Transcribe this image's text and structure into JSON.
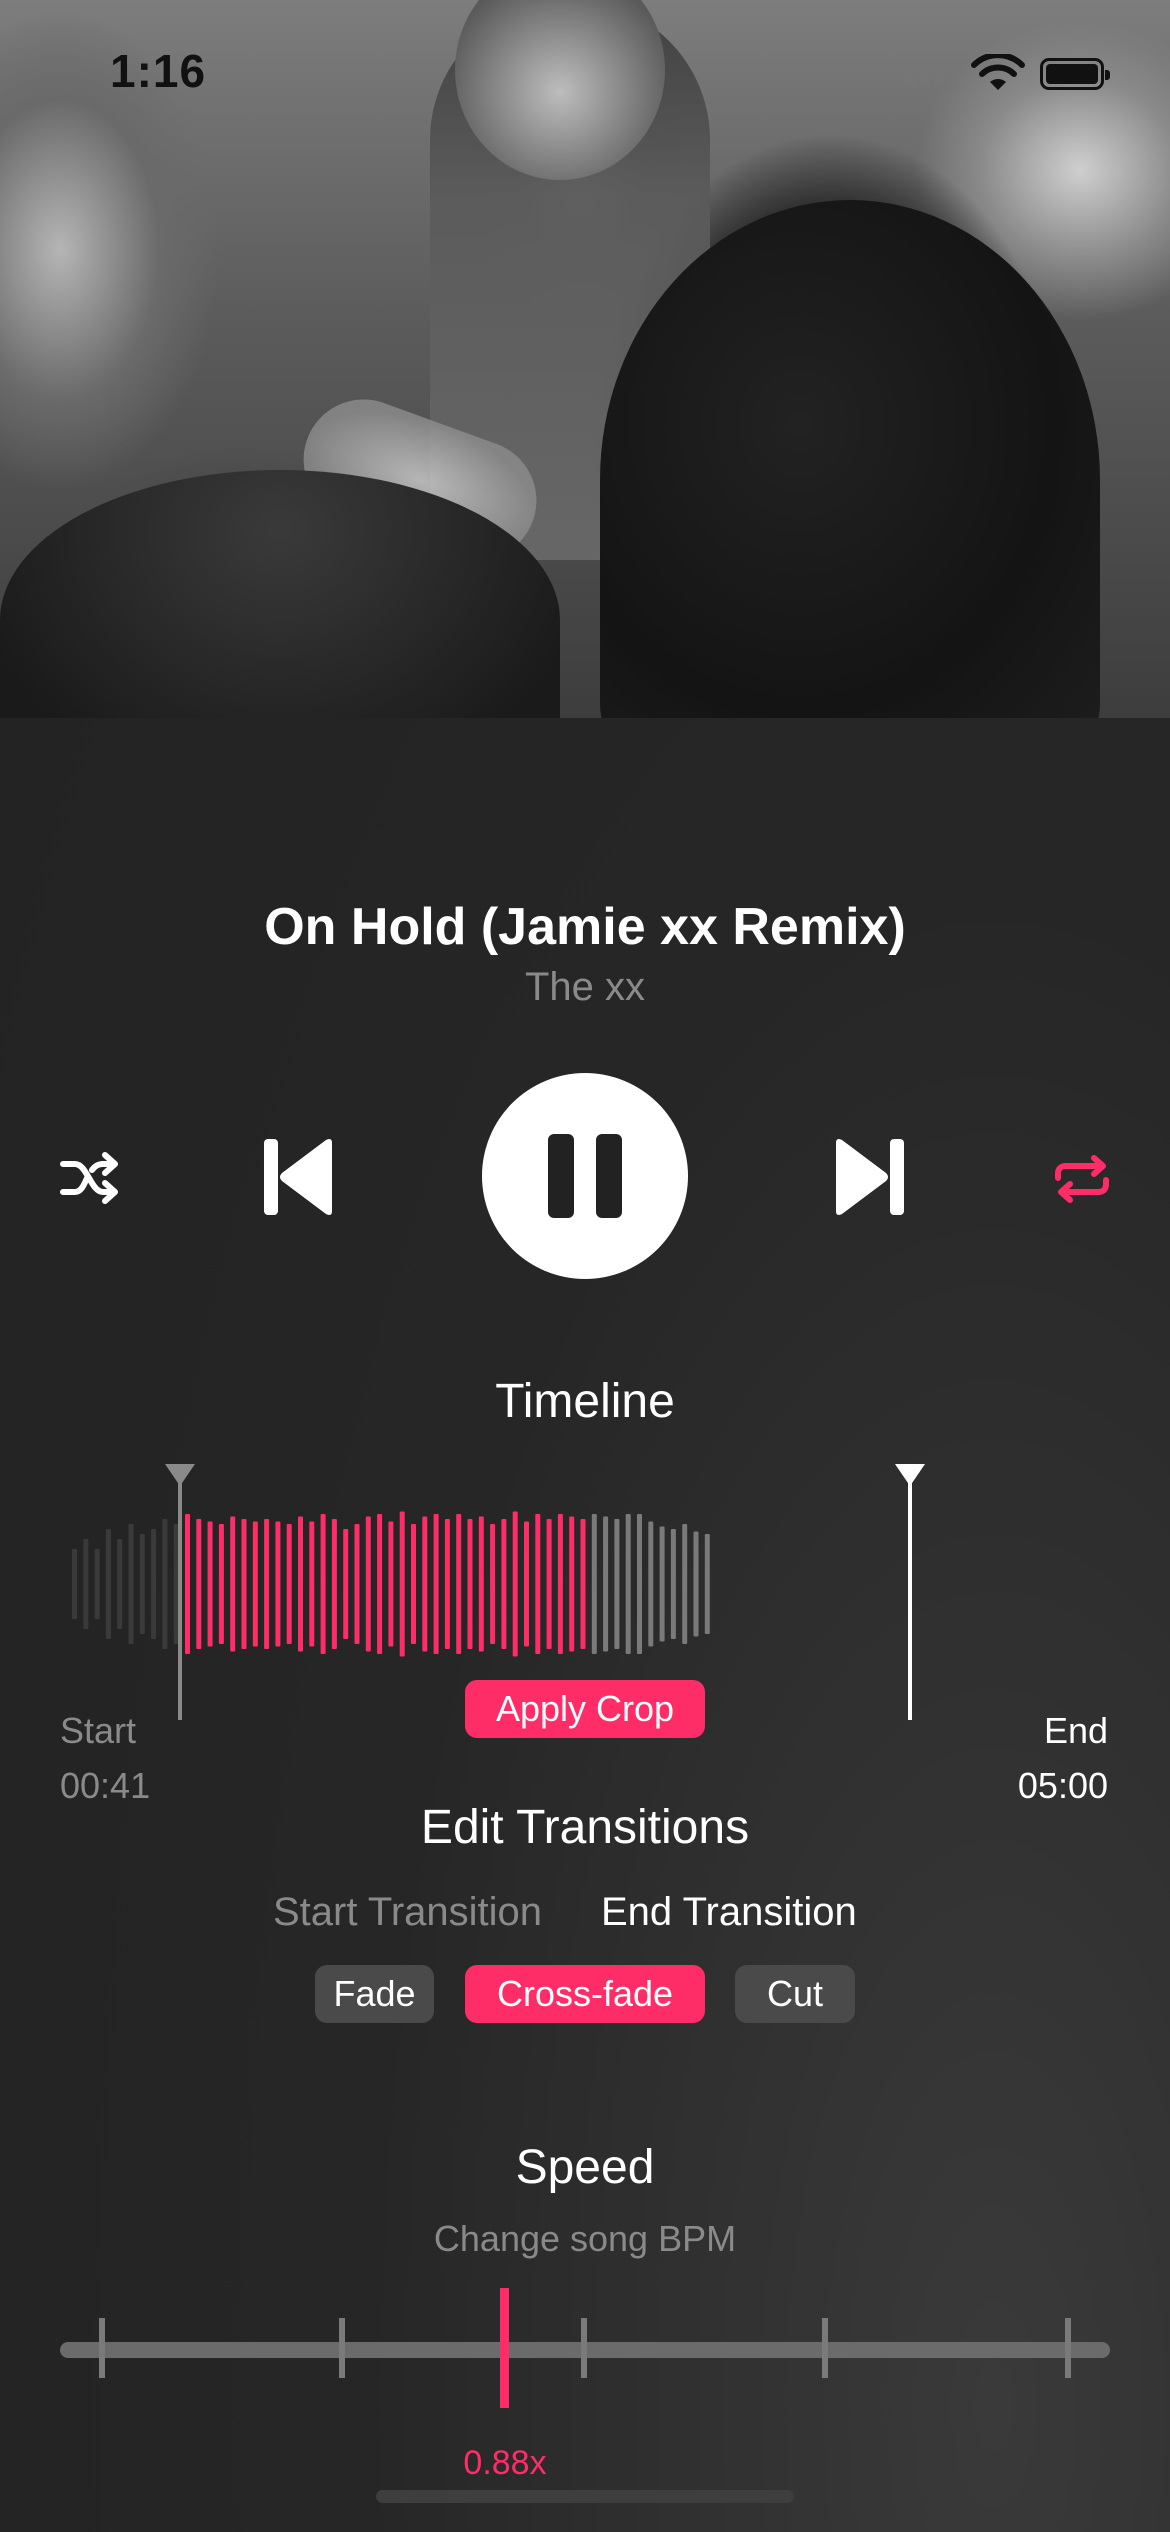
{
  "status_bar": {
    "time": "1:16"
  },
  "track": {
    "title": "On Hold (Jamie xx Remix)",
    "artist": "The xx"
  },
  "controls": {
    "shuffle_icon": "shuffle-icon",
    "previous_icon": "skip-back-icon",
    "pause_icon": "pause-icon",
    "next_icon": "skip-forward-icon",
    "repeat_icon": "repeat-icon",
    "repeat_active": true,
    "accent_color": "#FF2D67"
  },
  "timeline": {
    "heading": "Timeline",
    "start_label": "Start",
    "start_time": "00:41",
    "end_label": "End",
    "end_time": "05:00",
    "apply_crop_label": "Apply Crop"
  },
  "transitions": {
    "heading": "Edit Transitions",
    "tabs": [
      {
        "label": "Start Transition",
        "active": false
      },
      {
        "label": "End Transition",
        "active": true
      }
    ],
    "options": [
      {
        "label": "Fade",
        "selected": false
      },
      {
        "label": "Cross-fade",
        "selected": true
      },
      {
        "label": "Cut",
        "selected": false
      }
    ]
  },
  "speed": {
    "heading": "Speed",
    "subtitle": "Change song BPM",
    "value_label": "0.88x"
  }
}
